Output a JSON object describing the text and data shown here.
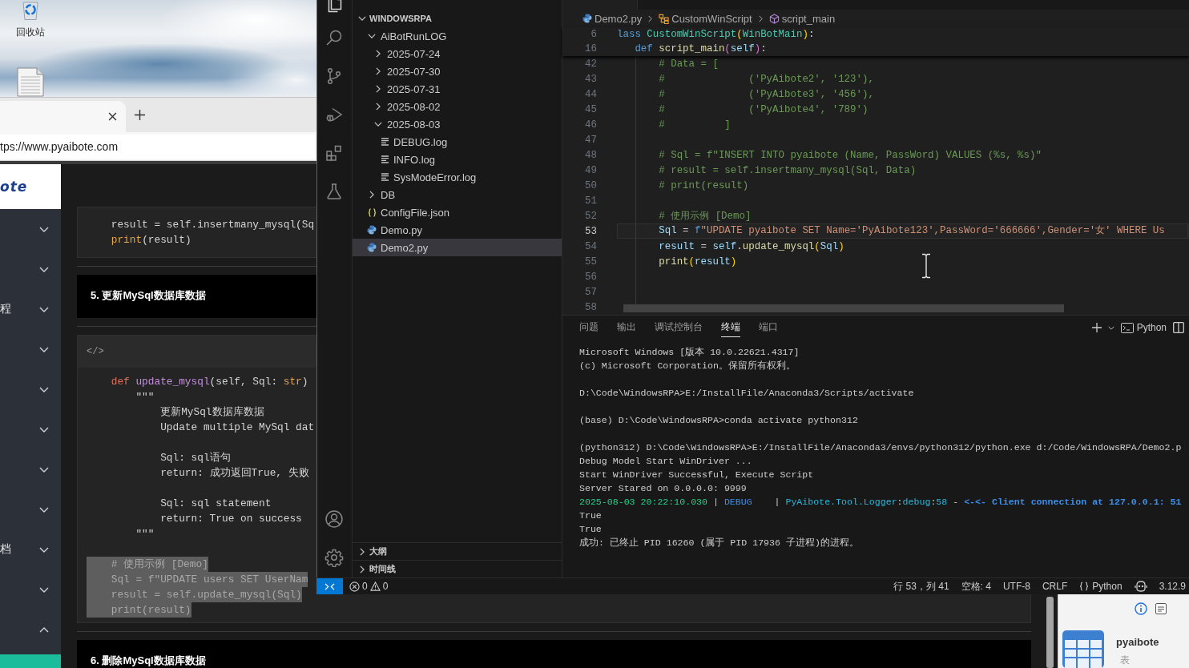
{
  "desktop": {
    "icons": [
      {
        "kind": "recycle-bin",
        "label": "回收站"
      },
      {
        "kind": "document"
      }
    ]
  },
  "browser": {
    "address": "tps://www.pyaibote.com",
    "logo": "ote",
    "nav": [
      {
        "expanded": false
      },
      {
        "expanded": false
      },
      {
        "label": "程",
        "expanded": false
      },
      {
        "expanded": false
      },
      {
        "expanded": false
      },
      {
        "expanded": false
      },
      {
        "expanded": false
      },
      {
        "expanded": false
      },
      {
        "label": "档",
        "expanded": false
      },
      {
        "expanded": false
      },
      {
        "expanded": true,
        "children": [
          {
            "selected": true
          }
        ]
      }
    ],
    "sections": [
      {
        "kind": "code",
        "groups": [
          [
            {
              "selected": false,
              "tokens": [
                {
                  "text": "    result = self.insertmany_mysql(Sq",
                  "kind": "plain"
                }
              ]
            },
            {
              "selected": false,
              "tokens": [
                {
                  "text": "    print",
                  "kind": "builtin"
                },
                {
                  "text": "(result)",
                  "kind": "plain"
                }
              ]
            }
          ]
        ]
      },
      {
        "kind": "heading",
        "text": "5. 更新MySql数据库数据"
      },
      {
        "kind": "code",
        "label": "</>",
        "groups": [
          [
            {
              "selected": false,
              "tokens": [
                {
                  "text": "    def ",
                  "kind": "keyword"
                },
                {
                  "text": "update_mysql",
                  "kind": "function"
                },
                {
                  "text": "(self, Sql: ",
                  "kind": "plain"
                },
                {
                  "text": "str",
                  "kind": "builtin"
                },
                {
                  "text": ")",
                  "kind": "plain"
                }
              ]
            },
            {
              "selected": false,
              "tokens": [
                {
                  "text": "        \"\"\"",
                  "kind": "plain"
                }
              ]
            },
            {
              "selected": false,
              "tokens": [
                {
                  "text": "            更新MySql数据库数据",
                  "kind": "plain"
                }
              ]
            },
            {
              "selected": false,
              "tokens": [
                {
                  "text": "            Update multiple MySql dat",
                  "kind": "plain"
                }
              ]
            }
          ],
          [
            {
              "selected": false,
              "tokens": [
                {
                  "text": "            Sql: sql语句",
                  "kind": "plain"
                }
              ]
            },
            {
              "selected": false,
              "tokens": [
                {
                  "text": "            return: 成功返回True, 失败",
                  "kind": "plain"
                }
              ]
            }
          ],
          [
            {
              "selected": false,
              "tokens": [
                {
                  "text": "            Sql: sql statement",
                  "kind": "plain"
                }
              ]
            },
            {
              "selected": false,
              "tokens": [
                {
                  "text": "            return: True on success",
                  "kind": "plain"
                }
              ]
            },
            {
              "selected": false,
              "tokens": [
                {
                  "text": "        \"\"\"",
                  "kind": "plain"
                }
              ]
            }
          ],
          [
            {
              "selected": true,
              "tokens": [
                {
                  "text": "    # 使用示例 [Demo]",
                  "kind": "plain"
                }
              ]
            },
            {
              "selected": true,
              "tokens": [
                {
                  "text": "    Sql = f\"UPDATE users SET UserNam",
                  "kind": "plain"
                }
              ]
            },
            {
              "selected": true,
              "tokens": [
                {
                  "text": "    result = self.update_mysql(Sql)",
                  "kind": "plain"
                }
              ]
            },
            {
              "selected": true,
              "tokens": [
                {
                  "text": "    print(result)",
                  "kind": "plain"
                }
              ]
            }
          ]
        ]
      },
      {
        "kind": "heading",
        "text": "6. 删除MySql数据库数据"
      }
    ]
  },
  "vscode": {
    "activity": [
      {
        "kind": "explorer",
        "selected": true
      },
      {
        "kind": "search",
        "selected": false
      },
      {
        "kind": "source-control",
        "selected": false
      },
      {
        "kind": "run-debug",
        "selected": false
      },
      {
        "kind": "extensions",
        "selected": false
      },
      {
        "kind": "testing",
        "selected": false
      }
    ],
    "activity_bottom": [
      {
        "kind": "account"
      },
      {
        "kind": "settings"
      }
    ],
    "explorer": {
      "root": "WINDOWSRPA",
      "expanded": true,
      "tree": [
        {
          "label": "AiBotRunLOG",
          "kind": "folder",
          "expanded": true,
          "selected": false,
          "children": [
            {
              "label": "2025-07-24",
              "kind": "folder",
              "expanded": false,
              "selected": false
            },
            {
              "label": "2025-07-30",
              "kind": "folder",
              "expanded": false,
              "selected": false
            },
            {
              "label": "2025-07-31",
              "kind": "folder",
              "expanded": false,
              "selected": false
            },
            {
              "label": "2025-08-02",
              "kind": "folder",
              "expanded": false,
              "selected": false
            },
            {
              "label": "2025-08-03",
              "kind": "folder",
              "expanded": true,
              "selected": false,
              "children": [
                {
                  "label": "DEBUG.log",
                  "kind": "log",
                  "selected": false
                },
                {
                  "label": "INFO.log",
                  "kind": "log",
                  "selected": false
                },
                {
                  "label": "SysModeError.log",
                  "kind": "log",
                  "selected": false
                }
              ]
            }
          ]
        },
        {
          "label": "DB",
          "kind": "folder",
          "expanded": false,
          "selected": false
        },
        {
          "label": "ConfigFile.json",
          "kind": "json",
          "selected": false
        },
        {
          "label": "Demo.py",
          "kind": "python",
          "selected": false
        },
        {
          "label": "Demo2.py",
          "kind": "python",
          "selected": true
        }
      ],
      "sections": [
        {
          "label": "大纲",
          "expanded": false
        },
        {
          "label": "时间线",
          "expanded": false
        }
      ]
    },
    "breadcrumb": [
      {
        "label": "Demo2.py",
        "kind": "python"
      },
      {
        "label": "CustomWinScript",
        "kind": "class"
      },
      {
        "label": "script_main",
        "kind": "method"
      }
    ],
    "sticky": [
      {
        "number": "6",
        "tokens": [
          {
            "text": "lass ",
            "kind": "keyword"
          },
          {
            "text": "CustomWinScript",
            "kind": "class"
          },
          {
            "text": "(",
            "kind": "bracket"
          },
          {
            "text": "WinBotMain",
            "kind": "class"
          },
          {
            "text": ")",
            "kind": "bracket"
          },
          {
            "text": ":",
            "kind": "plain"
          }
        ]
      },
      {
        "number": "16",
        "tokens": [
          {
            "text": "   def ",
            "kind": "keyword"
          },
          {
            "text": "script_main",
            "kind": "function"
          },
          {
            "text": "(",
            "kind": "bracket2"
          },
          {
            "text": "self",
            "kind": "variable"
          },
          {
            "text": ")",
            "kind": "bracket2"
          },
          {
            "text": ":",
            "kind": "plain"
          }
        ]
      }
    ],
    "code": [
      {
        "number": "42",
        "active": false,
        "tokens": [
          {
            "text": "       # Data = [",
            "kind": "comment"
          }
        ]
      },
      {
        "number": "43",
        "active": false,
        "tokens": [
          {
            "text": "       #              ('PyAibote2', '123'),",
            "kind": "comment"
          }
        ]
      },
      {
        "number": "44",
        "active": false,
        "tokens": [
          {
            "text": "       #              ('PyAibote3', '456'),",
            "kind": "comment"
          }
        ]
      },
      {
        "number": "45",
        "active": false,
        "tokens": [
          {
            "text": "       #              ('PyAibote4', '789')",
            "kind": "comment"
          }
        ]
      },
      {
        "number": "46",
        "active": false,
        "tokens": [
          {
            "text": "       #          ]",
            "kind": "comment"
          }
        ]
      },
      {
        "number": "47",
        "active": false
      },
      {
        "number": "48",
        "active": false,
        "tokens": [
          {
            "text": "       # Sql = f\"INSERT INTO pyaibote (Name, PassWord) VALUES (%s, %s)\"",
            "kind": "comment"
          }
        ]
      },
      {
        "number": "49",
        "active": false,
        "tokens": [
          {
            "text": "       # result = self.insertmany_mysql(Sql, Data)",
            "kind": "comment"
          }
        ]
      },
      {
        "number": "50",
        "active": false,
        "tokens": [
          {
            "text": "       # print(result)",
            "kind": "comment"
          }
        ]
      },
      {
        "number": "51",
        "active": false
      },
      {
        "number": "52",
        "active": false,
        "tokens": [
          {
            "text": "       # 使用示例 [Demo]",
            "kind": "comment"
          }
        ]
      },
      {
        "number": "53",
        "active": true,
        "tokens": [
          {
            "text": "       Sql",
            "kind": "variable"
          },
          {
            "text": " = ",
            "kind": "plain"
          },
          {
            "text": "f",
            "kind": "keyword"
          },
          {
            "text": "\"UPDATE pyaibote SET Name='PyAibote123',PassWord='666666',Gender='女' WHERE Us",
            "kind": "string"
          }
        ]
      },
      {
        "number": "54",
        "active": false,
        "tokens": [
          {
            "text": "       result",
            "kind": "variable"
          },
          {
            "text": " = ",
            "kind": "plain"
          },
          {
            "text": "self",
            "kind": "variable"
          },
          {
            "text": ".",
            "kind": "plain"
          },
          {
            "text": "update_mysql",
            "kind": "function"
          },
          {
            "text": "(",
            "kind": "bracket"
          },
          {
            "text": "Sql",
            "kind": "variable"
          },
          {
            "text": ")",
            "kind": "bracket"
          }
        ]
      },
      {
        "number": "55",
        "active": false,
        "tokens": [
          {
            "text": "       print",
            "kind": "function"
          },
          {
            "text": "(",
            "kind": "bracket"
          },
          {
            "text": "result",
            "kind": "variable"
          },
          {
            "text": ")",
            "kind": "bracket"
          }
        ]
      },
      {
        "number": "56",
        "active": false
      },
      {
        "number": "57",
        "active": false
      },
      {
        "number": "58",
        "active": false
      }
    ],
    "panel": {
      "tabs": [
        {
          "label": "问题",
          "selected": false
        },
        {
          "label": "输出",
          "selected": false
        },
        {
          "label": "调试控制台",
          "selected": false
        },
        {
          "label": "终端",
          "selected": true
        },
        {
          "label": "端口",
          "selected": false
        }
      ],
      "profile": "Python",
      "output": [
        [
          {
            "segments": [
              {
                "text": "Microsoft Windows [版本 10.0.22621.4317]",
                "kind": "plain"
              }
            ]
          },
          {
            "segments": [
              {
                "text": "(c) Microsoft Corporation。保留所有权利。",
                "kind": "plain"
              }
            ]
          }
        ],
        [
          {
            "segments": [
              {
                "text": "D:\\Code\\WindowsRPA>E:/InstallFile/Anaconda3/Scripts/activate",
                "kind": "plain"
              }
            ]
          }
        ],
        [
          {
            "segments": [
              {
                "text": "(base) D:\\Code\\WindowsRPA>conda activate python312",
                "kind": "plain"
              }
            ]
          }
        ],
        [
          {
            "segments": [
              {
                "text": "(python312) D:\\Code\\WindowsRPA>E:/InstallFile/Anaconda3/envs/python312/python.exe d:/Code/WindowsRPA/Demo2.p",
                "kind": "plain"
              }
            ]
          },
          {
            "segments": [
              {
                "text": "Debug Model Start WinDriver ...",
                "kind": "plain"
              }
            ]
          },
          {
            "segments": [
              {
                "text": "Start WinDriver Successful, Execute Script",
                "kind": "plain"
              }
            ]
          },
          {
            "segments": [
              {
                "text": "Server Stared on 0.0.0.0: 9999",
                "kind": "plain"
              }
            ]
          },
          {
            "segments": [
              {
                "text": "2025-08-03 20:22:10.030",
                "kind": "time"
              },
              {
                "text": " | ",
                "kind": "plain"
              },
              {
                "text": "DEBUG    ",
                "kind": "level"
              },
              {
                "text": "| ",
                "kind": "plain"
              },
              {
                "text": "PyAibote.Tool.Logger",
                "kind": "source"
              },
              {
                "text": ":",
                "kind": "plain"
              },
              {
                "text": "debug",
                "kind": "source"
              },
              {
                "text": ":",
                "kind": "plain"
              },
              {
                "text": "58",
                "kind": "source"
              },
              {
                "text": " - ",
                "kind": "plain"
              },
              {
                "text": "<-<- Client connection at 127.0.0.1: 51",
                "kind": "message"
              }
            ]
          },
          {
            "segments": [
              {
                "text": "True",
                "kind": "plain"
              }
            ]
          },
          {
            "segments": [
              {
                "text": "True",
                "kind": "plain"
              }
            ]
          },
          {
            "segments": [
              {
                "text": "成功: 已终止 PID 16260 (属于 PID 17936 子进程)的进程。",
                "kind": "plain"
              }
            ]
          }
        ]
      ]
    },
    "status_bar": {
      "errors": "0",
      "warnings": "0",
      "items": [
        {
          "kind": "text",
          "label": "行 53，列 41"
        },
        {
          "kind": "text",
          "label": "空格: 4"
        },
        {
          "kind": "text",
          "label": "UTF-8"
        },
        {
          "kind": "text",
          "label": "CRLF"
        },
        {
          "kind": "language",
          "label": "Python"
        },
        {
          "kind": "copilot"
        },
        {
          "kind": "text",
          "label": "3.12.9"
        }
      ]
    }
  },
  "table_window": {
    "name": "pyaibote",
    "type": "表"
  }
}
